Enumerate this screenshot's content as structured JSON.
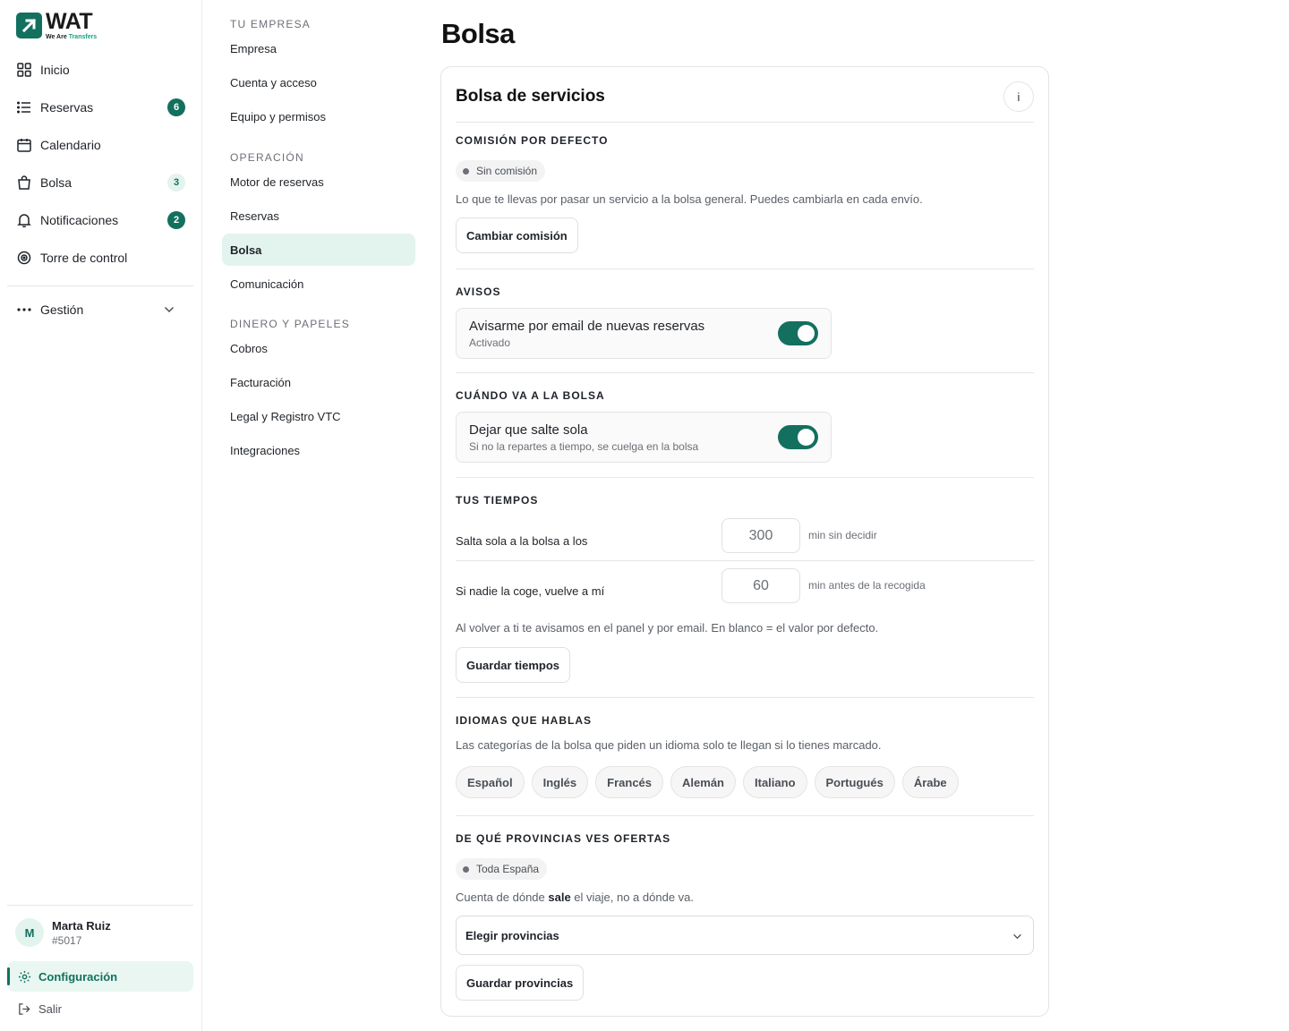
{
  "brand": {
    "name": "WAT",
    "tag_1": "We Are",
    "tag_2": "Transfers",
    "accent": "#13705f"
  },
  "nav": {
    "items": [
      {
        "label": "Inicio",
        "icon": "grid-icon"
      },
      {
        "label": "Reservas",
        "icon": "list-icon",
        "badge": "6"
      },
      {
        "label": "Calendario",
        "icon": "calendar-icon"
      },
      {
        "label": "Bolsa",
        "icon": "bag-icon",
        "badge": "3"
      },
      {
        "label": "Notificaciones",
        "icon": "bell-icon",
        "badge": "2"
      },
      {
        "label": "Torre de control",
        "icon": "target-icon"
      }
    ],
    "gestion": "Gestión"
  },
  "user": {
    "initial": "M",
    "name": "Marta Ruiz",
    "id": "#5017"
  },
  "footer": {
    "config": "Configuración",
    "exit": "Salir"
  },
  "settings": {
    "sections": [
      {
        "title": "TU EMPRESA",
        "items": [
          "Empresa",
          "Cuenta y acceso",
          "Equipo y permisos"
        ]
      },
      {
        "title": "OPERACIÓN",
        "items": [
          "Motor de reservas",
          "Reservas",
          "Bolsa",
          "Comunicación"
        ]
      },
      {
        "title": "DINERO Y PAPELES",
        "items": [
          "Cobros",
          "Facturación",
          "Legal y Registro VTC",
          "Integraciones"
        ]
      }
    ],
    "active": "Bolsa"
  },
  "page": {
    "title": "Bolsa"
  },
  "card": {
    "title": "Bolsa de servicios",
    "info": "i",
    "commission": {
      "title": "COMISIÓN POR DEFECTO",
      "chip": "Sin comisión",
      "desc": "Lo que te llevas por pasar un servicio a la bolsa general. Puedes cambiarla en cada envío.",
      "button": "Cambiar comisión"
    },
    "alerts": {
      "title": "AVISOS",
      "toggle_title": "Avisarme por email de nuevas reservas",
      "toggle_sub": "Activado",
      "enabled": true
    },
    "when": {
      "title": "CUÁNDO VA A LA BOLSA",
      "toggle_title": "Dejar que salte sola",
      "toggle_sub": "Si no la repartes a tiempo, se cuelga en la bolsa",
      "enabled": true
    },
    "times": {
      "title": "TUS TIEMPOS",
      "row1": {
        "label": "Salta sola a la bolsa a los",
        "value": "300",
        "unit": "min sin decidir"
      },
      "row2": {
        "label": "Si nadie la coge, vuelve a mí",
        "value": "60",
        "unit": "min antes de la recogida"
      },
      "note": "Al volver a ti te avisamos en el panel y por email. En blanco = el valor por defecto.",
      "button": "Guardar tiempos"
    },
    "languages": {
      "title": "IDIOMAS QUE HABLAS",
      "desc": "Las categorías de la bolsa que piden un idioma solo te llegan si lo tienes marcado.",
      "options": [
        "Español",
        "Inglés",
        "Francés",
        "Alemán",
        "Italiano",
        "Portugués",
        "Árabe"
      ]
    },
    "provinces": {
      "title": "DE QUÉ PROVINCIAS VES OFERTAS",
      "chip": "Toda España",
      "desc_1": "Cuenta de dónde ",
      "desc_bold": "sale",
      "desc_2": " el viaje, no a dónde va.",
      "select": "Elegir provincias",
      "button": "Guardar provincias"
    }
  }
}
